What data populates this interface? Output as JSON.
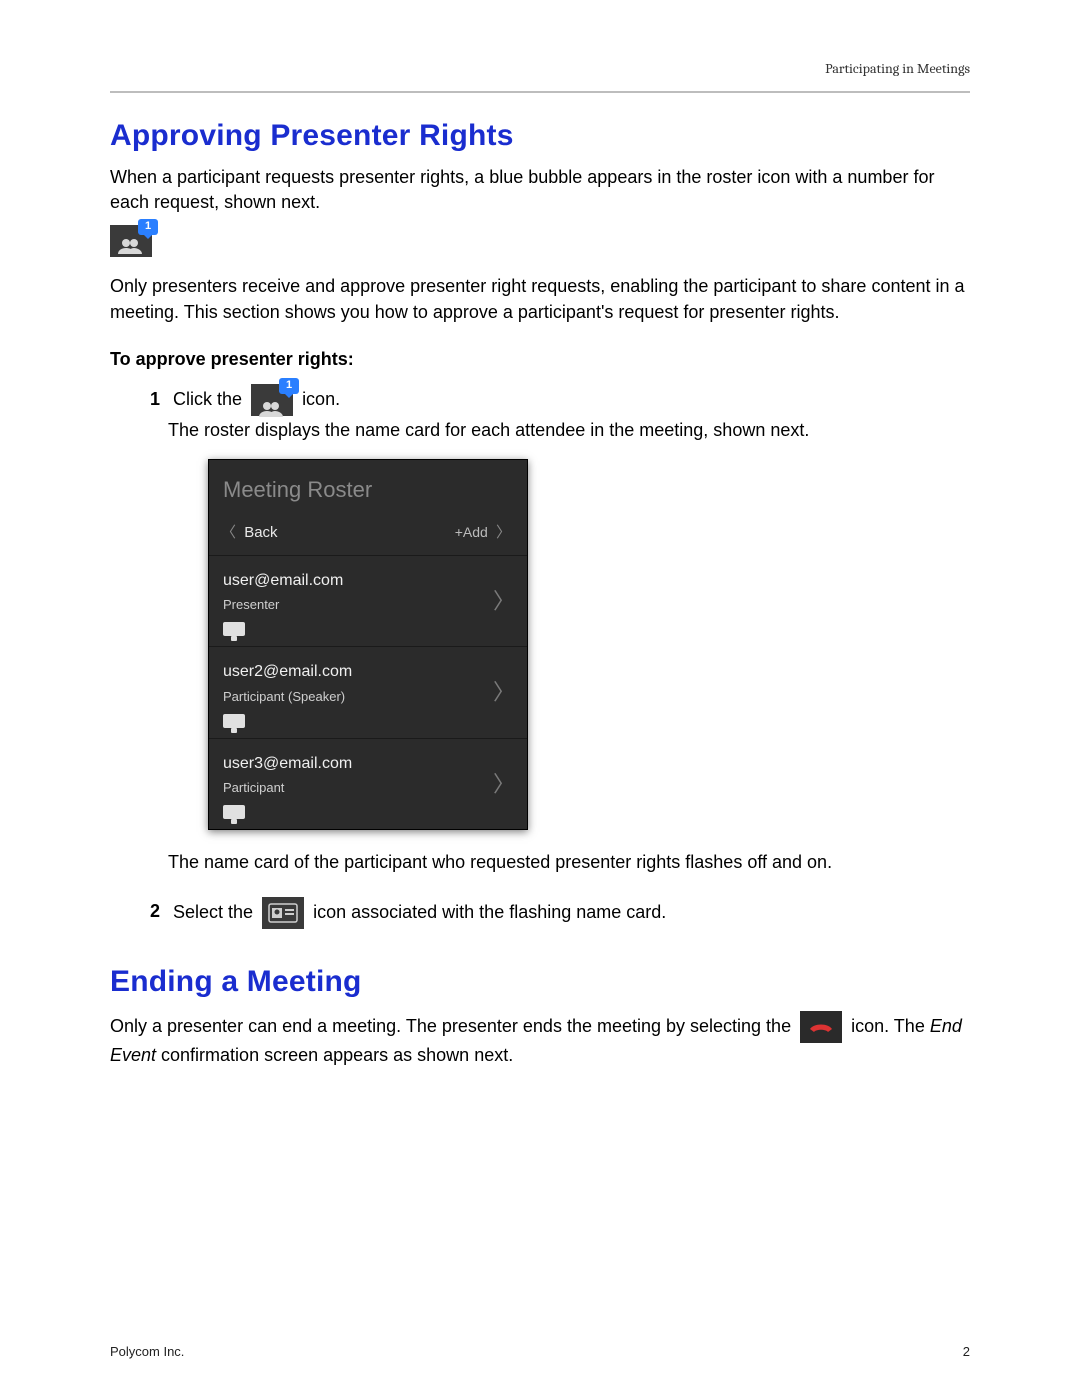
{
  "header": {
    "running": "Participating in Meetings"
  },
  "section1": {
    "title": "Approving Presenter Rights",
    "p1": "When a participant requests presenter rights, a blue bubble appears in the roster icon with a number for each request, shown next.",
    "p2": "Only presenters receive and approve presenter right requests, enabling the participant to share content in a meeting. This section shows you how to approve a participant's request for presenter rights.",
    "subhead": "To approve presenter rights:",
    "step1_a": "Click the ",
    "step1_b": " icon.",
    "step1_line2": "The roster displays the name card for each attendee in the meeting, shown next.",
    "after_roster": "The name card of the participant who requested presenter rights flashes off and on.",
    "step2_a": "Select the ",
    "step2_b": " icon associated with the flashing name card.",
    "badge": "1"
  },
  "roster": {
    "title": "Meeting Roster",
    "back": "Back",
    "add": "+Add",
    "cards": [
      {
        "email": "user@email.com",
        "role": "Presenter"
      },
      {
        "email": "user2@email.com",
        "role": "Participant (Speaker)"
      },
      {
        "email": "user3@email.com",
        "role": "Participant"
      }
    ]
  },
  "section2": {
    "title": "Ending a Meeting",
    "p1_a": "Only a presenter can end a meeting. The presenter ends the meeting by selecting the ",
    "p1_b": " icon. The ",
    "p1_italic": "End Event",
    "p1_c": " confirmation screen appears as shown next."
  },
  "footer": {
    "left": "Polycom Inc.",
    "right": "2"
  }
}
